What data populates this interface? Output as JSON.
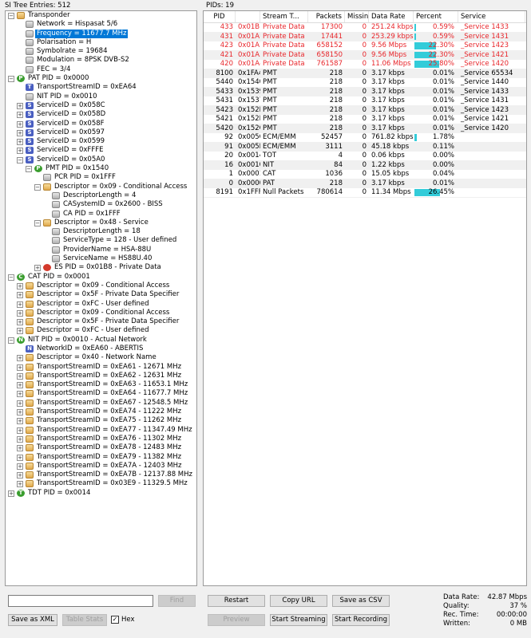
{
  "left_header": "SI Tree Entries: 512",
  "right_header": "PIDs: 19",
  "tree": [
    {
      "d": 0,
      "e": "-",
      "i": "folder",
      "t": "Transponder"
    },
    {
      "d": 1,
      "e": "",
      "i": "gray",
      "t": "Network = Hispasat 5/6"
    },
    {
      "d": 1,
      "e": "",
      "i": "gray",
      "t": "Frequency = 11677.7 MHz",
      "sel": true
    },
    {
      "d": 1,
      "e": "",
      "i": "gray",
      "t": "Polarisation = H"
    },
    {
      "d": 1,
      "e": "",
      "i": "gray",
      "t": "Symbolrate = 19684"
    },
    {
      "d": 1,
      "e": "",
      "i": "gray",
      "t": "Modulation = 8PSK DVB-S2"
    },
    {
      "d": 1,
      "e": "",
      "i": "gray",
      "t": "FEC = 3/4"
    },
    {
      "d": 0,
      "e": "-",
      "i": "green",
      "l": "P",
      "t": "PAT PID = 0x0000"
    },
    {
      "d": 1,
      "e": "",
      "i": "blue",
      "l": "T",
      "t": "TransportStreamID = 0xEA64"
    },
    {
      "d": 1,
      "e": "",
      "i": "gray",
      "t": "NIT PID = 0x0010"
    },
    {
      "d": 1,
      "e": "+",
      "i": "blue",
      "l": "S",
      "t": "ServiceID = 0x058C"
    },
    {
      "d": 1,
      "e": "+",
      "i": "blue",
      "l": "S",
      "t": "ServiceID = 0x058D"
    },
    {
      "d": 1,
      "e": "+",
      "i": "blue",
      "l": "S",
      "t": "ServiceID = 0x058F"
    },
    {
      "d": 1,
      "e": "+",
      "i": "blue",
      "l": "S",
      "t": "ServiceID = 0x0597"
    },
    {
      "d": 1,
      "e": "+",
      "i": "blue",
      "l": "S",
      "t": "ServiceID = 0x0599"
    },
    {
      "d": 1,
      "e": "+",
      "i": "blue",
      "l": "S",
      "t": "ServiceID = 0xFFFE"
    },
    {
      "d": 1,
      "e": "-",
      "i": "blue",
      "l": "S",
      "t": "ServiceID = 0x05A0"
    },
    {
      "d": 2,
      "e": "-",
      "i": "green",
      "l": "P",
      "t": "PMT PID = 0x1540"
    },
    {
      "d": 3,
      "e": "",
      "i": "gray",
      "t": "PCR PID = 0x1FFF"
    },
    {
      "d": 3,
      "e": "-",
      "i": "folder",
      "t": "Descriptor = 0x09 - Conditional Access"
    },
    {
      "d": 4,
      "e": "",
      "i": "gray",
      "t": "DescriptorLength = 4"
    },
    {
      "d": 4,
      "e": "",
      "i": "gray",
      "t": "CASystemID = 0x2600 - BISS"
    },
    {
      "d": 4,
      "e": "",
      "i": "gray",
      "t": "CA PID = 0x1FFF"
    },
    {
      "d": 3,
      "e": "-",
      "i": "folder",
      "t": "Descriptor = 0x48 - Service"
    },
    {
      "d": 4,
      "e": "",
      "i": "gray",
      "t": "DescriptorLength = 18"
    },
    {
      "d": 4,
      "e": "",
      "i": "gray",
      "t": "ServiceType = 128 - User defined"
    },
    {
      "d": 4,
      "e": "",
      "i": "gray",
      "t": "ProviderName = HSA-88U"
    },
    {
      "d": 4,
      "e": "",
      "i": "gray",
      "t": "ServiceName = HS88U.40"
    },
    {
      "d": 3,
      "e": "+",
      "i": "red",
      "t": "ES PID = 0x01B8 - Private Data"
    },
    {
      "d": 0,
      "e": "-",
      "i": "green",
      "l": "C",
      "t": "CAT PID = 0x0001"
    },
    {
      "d": 1,
      "e": "+",
      "i": "folder",
      "t": "Descriptor = 0x09 - Conditional Access"
    },
    {
      "d": 1,
      "e": "+",
      "i": "folder",
      "t": "Descriptor = 0x5F - Private Data Specifier"
    },
    {
      "d": 1,
      "e": "+",
      "i": "folder",
      "t": "Descriptor = 0xFC - User defined"
    },
    {
      "d": 1,
      "e": "+",
      "i": "folder",
      "t": "Descriptor = 0x09 - Conditional Access"
    },
    {
      "d": 1,
      "e": "+",
      "i": "folder",
      "t": "Descriptor = 0x5F - Private Data Specifier"
    },
    {
      "d": 1,
      "e": "+",
      "i": "folder",
      "t": "Descriptor = 0xFC - User defined"
    },
    {
      "d": 0,
      "e": "-",
      "i": "green",
      "l": "N",
      "t": "NIT PID = 0x0010 - Actual Network"
    },
    {
      "d": 1,
      "e": "",
      "i": "blue",
      "l": "N",
      "t": "NetworkID = 0xEA60 - ABERTIS"
    },
    {
      "d": 1,
      "e": "+",
      "i": "folder",
      "t": "Descriptor = 0x40 - Network Name"
    },
    {
      "d": 1,
      "e": "+",
      "i": "folder",
      "t": "TransportStreamID = 0xEA61 - 12671 MHz"
    },
    {
      "d": 1,
      "e": "+",
      "i": "folder",
      "t": "TransportStreamID = 0xEA62 - 12631 MHz"
    },
    {
      "d": 1,
      "e": "+",
      "i": "folder",
      "t": "TransportStreamID = 0xEA63 - 11653.1 MHz"
    },
    {
      "d": 1,
      "e": "+",
      "i": "folder",
      "t": "TransportStreamID = 0xEA64 - 11677.7 MHz"
    },
    {
      "d": 1,
      "e": "+",
      "i": "folder",
      "t": "TransportStreamID = 0xEA67 - 12548.5 MHz"
    },
    {
      "d": 1,
      "e": "+",
      "i": "folder",
      "t": "TransportStreamID = 0xEA74 - 11222 MHz"
    },
    {
      "d": 1,
      "e": "+",
      "i": "folder",
      "t": "TransportStreamID = 0xEA75 - 11262 MHz"
    },
    {
      "d": 1,
      "e": "+",
      "i": "folder",
      "t": "TransportStreamID = 0xEA77 - 11347.49 MHz"
    },
    {
      "d": 1,
      "e": "+",
      "i": "folder",
      "t": "TransportStreamID = 0xEA76 - 11302 MHz"
    },
    {
      "d": 1,
      "e": "+",
      "i": "folder",
      "t": "TransportStreamID = 0xEA78 - 12483 MHz"
    },
    {
      "d": 1,
      "e": "+",
      "i": "folder",
      "t": "TransportStreamID = 0xEA79 - 11382 MHz"
    },
    {
      "d": 1,
      "e": "+",
      "i": "folder",
      "t": "TransportStreamID = 0xEA7A - 12403 MHz"
    },
    {
      "d": 1,
      "e": "+",
      "i": "folder",
      "t": "TransportStreamID = 0xEA7B - 12137.88 MHz"
    },
    {
      "d": 1,
      "e": "+",
      "i": "folder",
      "t": "TransportStreamID = 0x03E9 - 11329.5 MHz"
    },
    {
      "d": 0,
      "e": "+",
      "i": "green",
      "l": "T",
      "t": "TDT PID = 0x0014"
    }
  ],
  "columns": [
    "PID",
    "",
    "Stream T...",
    "Packets",
    "Missing",
    "Data Rate",
    "Percent",
    "Service"
  ],
  "pids": [
    {
      "pid": "433",
      "hex": "0x01B1",
      "type": "Private Data",
      "packets": "17300",
      "missing": "0",
      "rate": "251.24 kbps",
      "pct": "0.59%",
      "pv": 0.59,
      "svc": "_Service 1433",
      "red": true
    },
    {
      "pid": "431",
      "hex": "0x01AF",
      "type": "Private Data",
      "packets": "17441",
      "missing": "0",
      "rate": "253.29 kbps",
      "pct": "0.59%",
      "pv": 0.59,
      "svc": "_Service 1431",
      "red": true
    },
    {
      "pid": "423",
      "hex": "0x01A7",
      "type": "Private Data",
      "packets": "658152",
      "missing": "0",
      "rate": "9.56 Mbps",
      "pct": "22.30%",
      "pv": 22.3,
      "svc": "_Service 1423",
      "red": true
    },
    {
      "pid": "421",
      "hex": "0x01A5",
      "type": "Private Data",
      "packets": "658150",
      "missing": "0",
      "rate": "9.56 Mbps",
      "pct": "22.30%",
      "pv": 22.3,
      "svc": "_Service 1421",
      "red": true
    },
    {
      "pid": "420",
      "hex": "0x01A4",
      "type": "Private Data",
      "packets": "761587",
      "missing": "0",
      "rate": "11.06 Mbps",
      "pct": "25.80%",
      "pv": 25.8,
      "svc": "_Service 1420",
      "red": true
    },
    {
      "pid": "8100",
      "hex": "0x1FA4",
      "type": "PMT",
      "packets": "218",
      "missing": "0",
      "rate": "3.17 kbps",
      "pct": "0.01%",
      "pv": 0.01,
      "svc": "_Service 65534"
    },
    {
      "pid": "5440",
      "hex": "0x1540",
      "type": "PMT",
      "packets": "218",
      "missing": "0",
      "rate": "3.17 kbps",
      "pct": "0.01%",
      "pv": 0.01,
      "svc": "_Service 1440"
    },
    {
      "pid": "5433",
      "hex": "0x1539",
      "type": "PMT",
      "packets": "218",
      "missing": "0",
      "rate": "3.17 kbps",
      "pct": "0.01%",
      "pv": 0.01,
      "svc": "_Service 1433"
    },
    {
      "pid": "5431",
      "hex": "0x1537",
      "type": "PMT",
      "packets": "218",
      "missing": "0",
      "rate": "3.17 kbps",
      "pct": "0.01%",
      "pv": 0.01,
      "svc": "_Service 1431"
    },
    {
      "pid": "5423",
      "hex": "0x152F",
      "type": "PMT",
      "packets": "218",
      "missing": "0",
      "rate": "3.17 kbps",
      "pct": "0.01%",
      "pv": 0.01,
      "svc": "_Service 1423"
    },
    {
      "pid": "5421",
      "hex": "0x152D",
      "type": "PMT",
      "packets": "218",
      "missing": "0",
      "rate": "3.17 kbps",
      "pct": "0.01%",
      "pv": 0.01,
      "svc": "_Service 1421"
    },
    {
      "pid": "5420",
      "hex": "0x152C",
      "type": "PMT",
      "packets": "218",
      "missing": "0",
      "rate": "3.17 kbps",
      "pct": "0.01%",
      "pv": 0.01,
      "svc": "_Service 1420"
    },
    {
      "pid": "92",
      "hex": "0x005C",
      "type": "ECM/EMM",
      "packets": "52457",
      "missing": "0",
      "rate": "761.82 kbps",
      "pct": "1.78%",
      "pv": 1.78,
      "svc": ""
    },
    {
      "pid": "91",
      "hex": "0x005B",
      "type": "ECM/EMM",
      "packets": "3111",
      "missing": "0",
      "rate": "45.18 kbps",
      "pct": "0.11%",
      "pv": 0.11,
      "svc": ""
    },
    {
      "pid": "20",
      "hex": "0x0014",
      "type": "TOT",
      "packets": "4",
      "missing": "0",
      "rate": "0.06 kbps",
      "pct": "0.00%",
      "pv": 0,
      "svc": ""
    },
    {
      "pid": "16",
      "hex": "0x0010",
      "type": "NIT",
      "packets": "84",
      "missing": "0",
      "rate": "1.22 kbps",
      "pct": "0.00%",
      "pv": 0,
      "svc": ""
    },
    {
      "pid": "1",
      "hex": "0x0001",
      "type": "CAT",
      "packets": "1036",
      "missing": "0",
      "rate": "15.05 kbps",
      "pct": "0.04%",
      "pv": 0.04,
      "svc": ""
    },
    {
      "pid": "0",
      "hex": "0x0000",
      "type": "PAT",
      "packets": "218",
      "missing": "0",
      "rate": "3.17 kbps",
      "pct": "0.01%",
      "pv": 0.01,
      "svc": ""
    },
    {
      "pid": "8191",
      "hex": "0x1FFF",
      "type": "Null Packets",
      "packets": "780614",
      "missing": "0",
      "rate": "11.34 Mbps",
      "pct": "26.45%",
      "pv": 26.45,
      "svc": ""
    }
  ],
  "bar_color": "#33ccd9",
  "red_color": "#e8252a",
  "buttons": {
    "find": "Find",
    "save_xml": "Save as XML",
    "table_stats": "Table Stats",
    "hex": "Hex",
    "restart": "Restart",
    "copy_url": "Copy URL",
    "save_csv": "Save as CSV",
    "preview": "Preview",
    "start_streaming": "Start Streaming",
    "start_recording": "Start Recording"
  },
  "search_value": "",
  "stats": [
    {
      "k": "Data Rate:",
      "v": "42.87 Mbps"
    },
    {
      "k": "Quality:",
      "v": "37 %"
    },
    {
      "k": "Rec. Time:",
      "v": "00:00:00"
    },
    {
      "k": "Written:",
      "v": "0 MB"
    }
  ]
}
